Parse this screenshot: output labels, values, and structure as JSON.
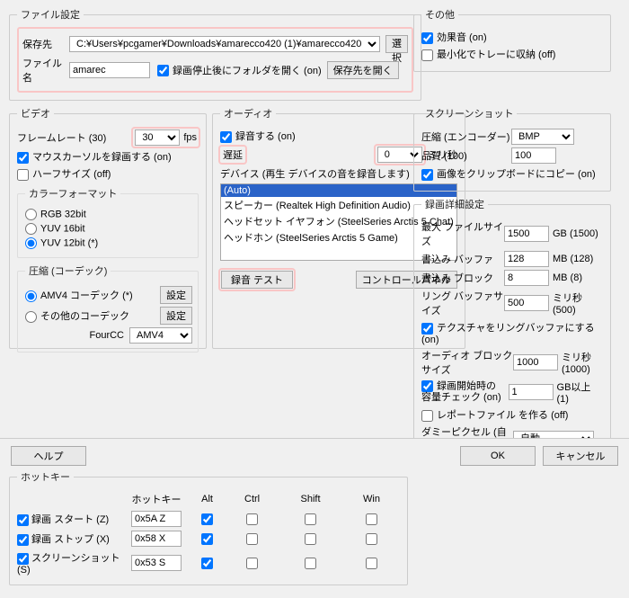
{
  "file": {
    "legend": "ファイル設定",
    "dest_label": "保存先",
    "dest_value": "C:¥Users¥pcgamer¥Downloads¥amarecco420 (1)¥amarecco420",
    "select_btn": "選択",
    "name_label": "ファイル名",
    "name_value": "amarec",
    "open_folder_label": "録画停止後にフォルダを開く (on)",
    "open_dest_btn": "保存先を開く"
  },
  "video": {
    "legend": "ビデオ",
    "frame_label": "フレームレート (30)",
    "frame_value": "30",
    "frame_unit": "fps",
    "cursor_label": "マウスカーソルを録画する (on)",
    "halfsize_label": "ハーフサイズ (off)",
    "colorformat": {
      "legend": "カラーフォーマット",
      "rgb": "RGB 32bit",
      "yuv16": "YUV 16bit",
      "yuv12": "YUV 12bit (*)"
    },
    "codec": {
      "legend": "圧縮 (コーデック)",
      "amv4": "AMV4 コーデック (*)",
      "other": "その他のコーデック",
      "set_btn": "設定",
      "fourcc_label": "FourCC",
      "fourcc_value": "AMV4"
    }
  },
  "audio": {
    "legend": "オーディオ",
    "rec_label": "録音する (on)",
    "delay_label": "遅延",
    "delay_value": "0",
    "delay_unit": "ミリ秒",
    "device_label": "デバイス (再生 デバイスの音を録音します)",
    "devices": [
      "(Auto)",
      "スピーカー (Realtek High Definition Audio)",
      "ヘッドセット イヤフォン (SteelSeries Arctis 5 Chat)",
      "ヘッドホン (SteelSeries Arctis 5 Game)"
    ],
    "test_btn": "録音 テスト",
    "ctrl_btn": "コントロールパネル"
  },
  "hotkey": {
    "legend": "ホットキー",
    "cols": {
      "key": "ホットキー",
      "alt": "Alt",
      "ctrl": "Ctrl",
      "shift": "Shift",
      "win": "Win"
    },
    "rows": [
      {
        "label": "録画 スタート (Z)",
        "key": "0x5A Z",
        "on": true,
        "alt": true
      },
      {
        "label": "録画 ストップ (X)",
        "key": "0x58 X",
        "on": true,
        "alt": true
      },
      {
        "label": "スクリーンショット (S)",
        "key": "0x53 S",
        "on": true,
        "alt": true
      }
    ]
  },
  "misc": {
    "legend": "その他",
    "sfx": "効果音 (on)",
    "tray": "最小化でトレーに収納 (off)"
  },
  "ss": {
    "legend": "スクリーンショット",
    "enc_label": "圧縮 (エンコーダー)",
    "enc_value": "BMP",
    "q_label": "品質 (100)",
    "q_value": "100",
    "clip_label": "画像をクリップボードにコピー (on)"
  },
  "rec": {
    "legend": "録画詳細設定",
    "maxfile_label": "最大 ファイルサイズ",
    "maxfile_value": "1500",
    "maxfile_unit": "GB (1500)",
    "wbuf_label": "書込み バッファ",
    "wbuf_value": "128",
    "wbuf_unit": "MB (128)",
    "wblk_label": "書込み ブロック",
    "wblk_value": "8",
    "wblk_unit": "MB (8)",
    "ring_label": "リング バッファサイズ",
    "ring_value": "500",
    "ring_unit": "ミリ秒 (500)",
    "tex_label": "テクスチャをリングバッファにする (on)",
    "audblk_label": "オーディオ ブロックサイズ",
    "audblk_value": "1000",
    "audblk_unit": "ミリ秒 (1000)",
    "capchk_label": "録画開始時の\n容量チェック (on)",
    "capchk_value": "1",
    "capchk_unit": "GB以上 (1)",
    "report_label": "レポートファイル を作る (off)",
    "dummy_label": "ダミーピクセル (自動)",
    "dummy_value": "自動"
  },
  "footer": {
    "help": "ヘルプ",
    "ok": "OK",
    "cancel": "キャンセル"
  }
}
